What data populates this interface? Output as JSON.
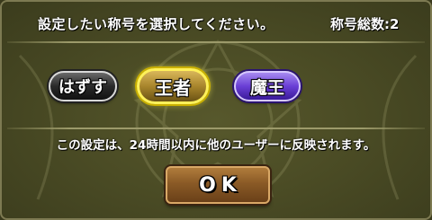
{
  "dialog": {
    "header_text": "設定したい称号を選択してください。",
    "header_count": "称号総数:2",
    "titles": [
      {
        "label": "はずす",
        "selected": false,
        "color": "#2a2a2a"
      },
      {
        "label": "王者",
        "selected": true,
        "color": "#a8852c"
      },
      {
        "label": "魔王",
        "selected": false,
        "color": "#6a3fd6"
      }
    ],
    "notice": "この設定は、24時間以内に他のユーザーに反映されます。",
    "ok_label": "OK"
  },
  "colors": {
    "panel": "#4b4c25",
    "selected_border": "#fff15a",
    "ok_button": "#8a5a26"
  }
}
